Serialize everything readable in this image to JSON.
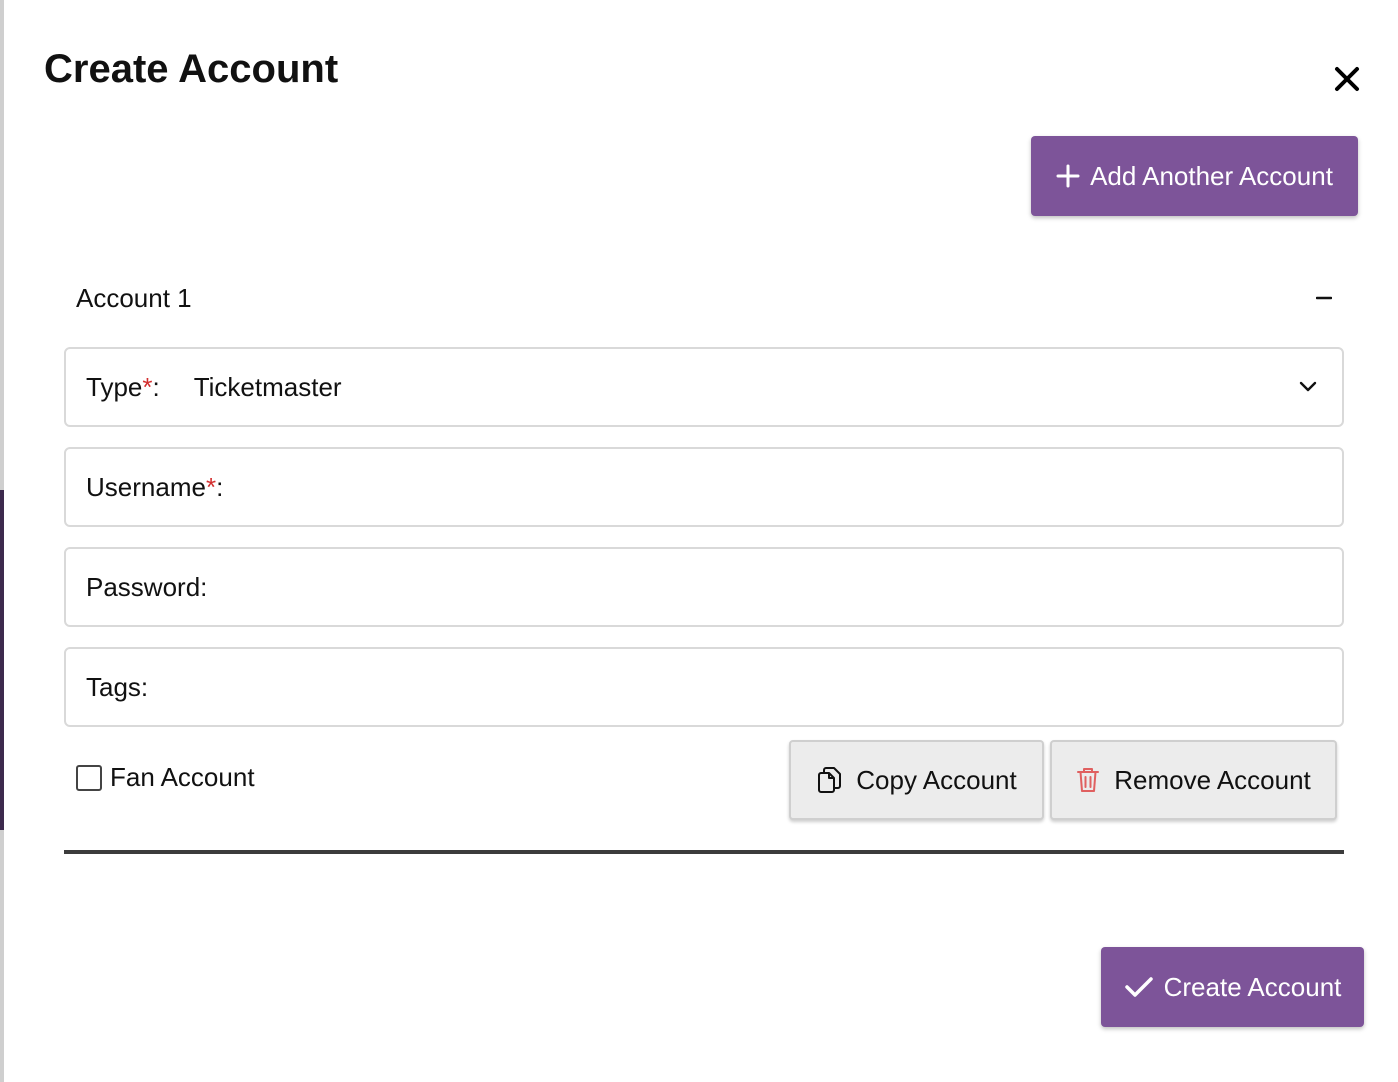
{
  "modal": {
    "title": "Create Account",
    "close_icon": "close-icon"
  },
  "actions": {
    "add_another_label": "Add Another Account",
    "create_label": "Create Account",
    "accent_color": "#7d5499"
  },
  "account": {
    "section_title": "Account 1",
    "collapse_symbol": "−",
    "fields": {
      "type_label": "Type",
      "type_value": "Ticketmaster",
      "username_label": "Username",
      "password_label": "Password:",
      "tags_label": "Tags:",
      "required_mark": "*",
      "colon": ":"
    },
    "fan_account_label": "Fan Account",
    "fan_account_checked": false,
    "copy_label": "Copy Account",
    "remove_label": "Remove Account",
    "remove_icon_color": "#e06060"
  }
}
